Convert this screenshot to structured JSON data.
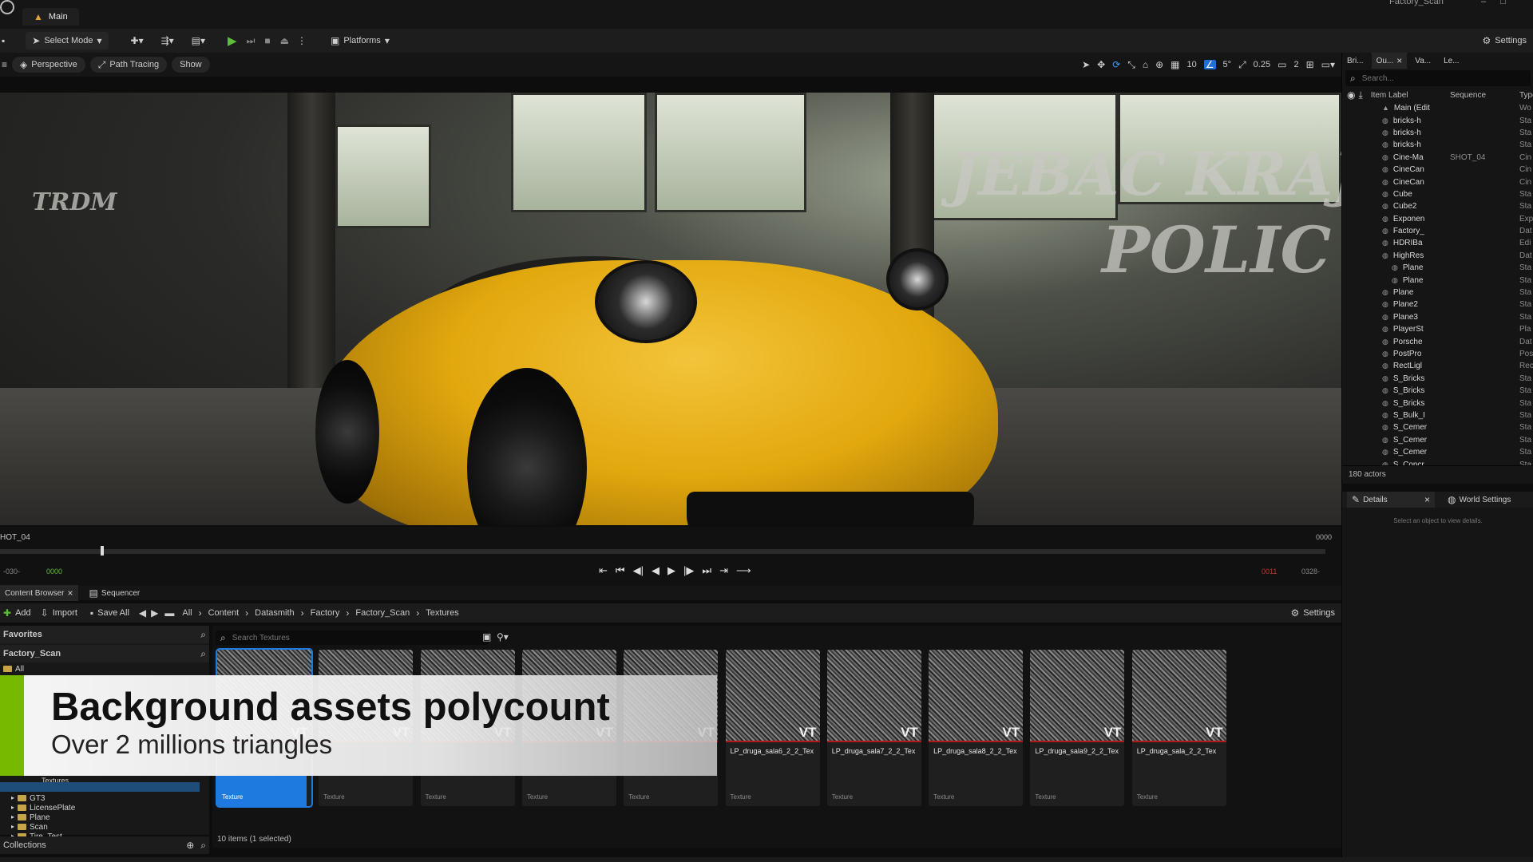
{
  "window": {
    "tab": "Main",
    "project": "Factory_Scan"
  },
  "toolbar": {
    "select_mode": "Select Mode",
    "platforms": "Platforms",
    "settings": "Settings"
  },
  "viewport_toolbar": {
    "perspective": "Perspective",
    "path_tracing": "Path Tracing",
    "show": "Show",
    "grid_value": "10",
    "angle_value": "5°",
    "scale_value": "0.25",
    "camera_speed": "2"
  },
  "outliner": {
    "tabs": [
      "Bri...",
      "Ou...",
      "Va...",
      "Le..."
    ],
    "search_placeholder": "Search...",
    "col_label": "Item Label",
    "col_sequence": "Sequence",
    "col_type": "Type",
    "rows": [
      {
        "label": "Main (Edit",
        "seq": "",
        "type": "Wo"
      },
      {
        "label": "bricks-h",
        "seq": "",
        "type": "Sta"
      },
      {
        "label": "bricks-h",
        "seq": "",
        "type": "Sta"
      },
      {
        "label": "bricks-h",
        "seq": "",
        "type": "Sta"
      },
      {
        "label": "Cine-Ma",
        "seq": "SHOT_04",
        "type": "Cin"
      },
      {
        "label": "CineCan",
        "seq": "",
        "type": "Cin"
      },
      {
        "label": "CineCan",
        "seq": "",
        "type": "Cin"
      },
      {
        "label": "Cube",
        "seq": "",
        "type": "Sta"
      },
      {
        "label": "Cube2",
        "seq": "",
        "type": "Sta"
      },
      {
        "label": "Exponen",
        "seq": "",
        "type": "Exp"
      },
      {
        "label": "Factory_",
        "seq": "",
        "type": "Dat"
      },
      {
        "label": "HDRIBa",
        "seq": "",
        "type": "Edi"
      },
      {
        "label": "HighRes",
        "seq": "",
        "type": "Dat"
      },
      {
        "label": "Plane",
        "seq": "",
        "type": "Sta"
      },
      {
        "label": "Plane",
        "seq": "",
        "type": "Sta"
      },
      {
        "label": "Plane",
        "seq": "",
        "type": "Sta"
      },
      {
        "label": "Plane2",
        "seq": "",
        "type": "Sta"
      },
      {
        "label": "Plane3",
        "seq": "",
        "type": "Sta"
      },
      {
        "label": "PlayerSt",
        "seq": "",
        "type": "Pla"
      },
      {
        "label": "Porsche",
        "seq": "",
        "type": "Dat"
      },
      {
        "label": "PostPro",
        "seq": "",
        "type": "Pos"
      },
      {
        "label": "RectLigl",
        "seq": "",
        "type": "Rec"
      },
      {
        "label": "S_Bricks",
        "seq": "",
        "type": "Sta"
      },
      {
        "label": "S_Bricks",
        "seq": "",
        "type": "Sta"
      },
      {
        "label": "S_Bricks",
        "seq": "",
        "type": "Sta"
      },
      {
        "label": "S_Bulk_I",
        "seq": "",
        "type": "Sta"
      },
      {
        "label": "S_Cemer",
        "seq": "",
        "type": "Sta"
      },
      {
        "label": "S_Cemer",
        "seq": "",
        "type": "Sta"
      },
      {
        "label": "S_Cemer",
        "seq": "",
        "type": "Sta"
      },
      {
        "label": "S_Concr",
        "seq": "",
        "type": "Sta"
      }
    ],
    "actor_count": "180 actors"
  },
  "details": {
    "tab_details": "Details",
    "tab_world": "World Settings",
    "hint": "Select an object to view details."
  },
  "sequencer": {
    "shot": "HOT_04",
    "end_frame": "0000",
    "start": "-030-",
    "current": "0000",
    "red": "0011",
    "end": "0328-"
  },
  "content_browser": {
    "tab_cb": "Content Browser",
    "tab_seq": "Sequencer",
    "add": "Add",
    "import": "Import",
    "save_all": "Save All",
    "settings": "Settings",
    "breadcrumb": [
      "All",
      "Content",
      "Datasmith",
      "Factory",
      "Factory_Scan",
      "Textures"
    ],
    "favorites": "Favorites",
    "project": "Factory_Scan",
    "all": "All",
    "search_placeholder": "Search Textures",
    "tree": [
      "Textures",
      "GT3",
      "LicensePlate",
      "Plane",
      "Scan",
      "Tire_Test"
    ],
    "collections": "Collections",
    "status": "10 items (1 selected)",
    "tiles": [
      {
        "name": "",
        "type": "Texture"
      },
      {
        "name": "",
        "type": "Texture"
      },
      {
        "name": "",
        "type": "Texture"
      },
      {
        "name": "",
        "type": "Texture"
      },
      {
        "name": "",
        "type": "Texture"
      },
      {
        "name": "LP_druga_sala6_2_2_Tex",
        "type": "Texture"
      },
      {
        "name": "LP_druga_sala7_2_2_Tex",
        "type": "Texture"
      },
      {
        "name": "LP_druga_sala8_2_2_Tex",
        "type": "Texture"
      },
      {
        "name": "LP_druga_sala9_2_2_Tex",
        "type": "Texture"
      },
      {
        "name": "LP_druga_sala_2_2_Tex",
        "type": "Texture"
      }
    ]
  },
  "overlay": {
    "title": "Background assets polycount",
    "subtitle": "Over 2 millions triangles"
  },
  "scene": {
    "graffiti_1": "JEBAC KRAJ",
    "graffiti_2": "POLIC",
    "graffiti_3": "TRDM"
  }
}
